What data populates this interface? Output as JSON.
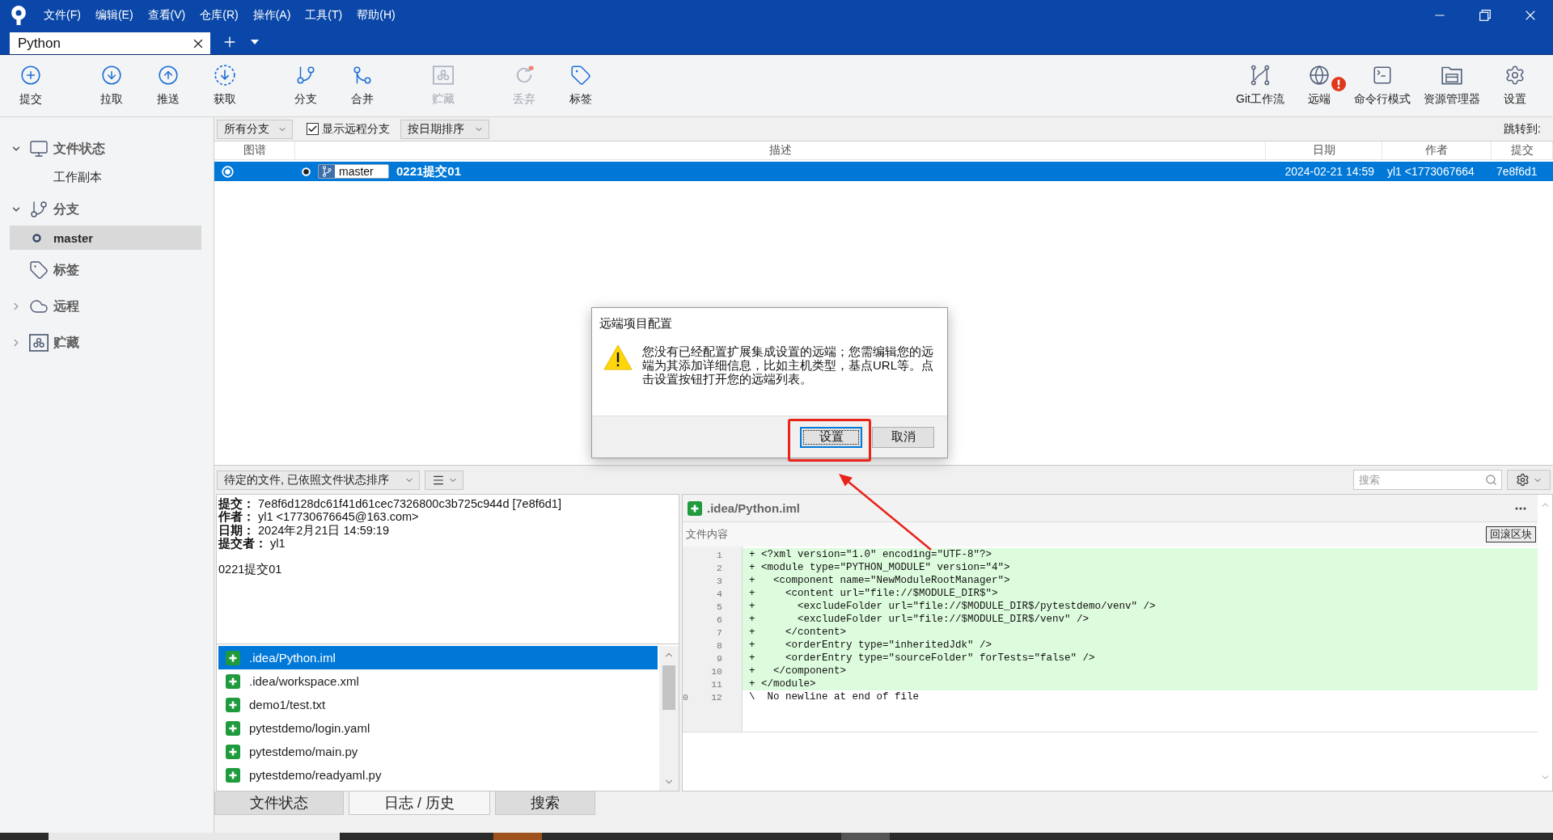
{
  "title_bar": {
    "menu": [
      "文件(F)",
      "编辑(E)",
      "查看(V)",
      "仓库(R)",
      "操作(A)",
      "工具(T)",
      "帮助(H)"
    ]
  },
  "repo_tabs": [
    {
      "label": "Python",
      "selected": true
    }
  ],
  "toolbar": {
    "left_groups": [
      [
        {
          "label": "提交",
          "kind": "commit",
          "disabled": false
        }
      ],
      [
        {
          "label": "拉取",
          "kind": "pull",
          "disabled": false
        },
        {
          "label": "推送",
          "kind": "push",
          "disabled": false
        },
        {
          "label": "获取",
          "kind": "fetch",
          "disabled": false
        }
      ],
      [
        {
          "label": "分支",
          "kind": "branch",
          "disabled": false
        },
        {
          "label": "合并",
          "kind": "merge",
          "disabled": false
        }
      ],
      [
        {
          "label": "贮藏",
          "kind": "stash",
          "disabled": true
        }
      ],
      [
        {
          "label": "丢弃",
          "kind": "discard",
          "disabled": true
        },
        {
          "label": "标签",
          "kind": "tag",
          "disabled": false
        }
      ]
    ],
    "right": [
      {
        "label": "Git工作流",
        "kind": "flow",
        "alert": false
      },
      {
        "label": "远端",
        "kind": "remote",
        "alert": true
      },
      {
        "label": "命令行模式",
        "kind": "terminal",
        "alert": false
      },
      {
        "label": "资源管理器",
        "kind": "explorer",
        "alert": false
      },
      {
        "label": "设置",
        "kind": "settings",
        "alert": false
      }
    ]
  },
  "sidebar": [
    {
      "label": "文件状态",
      "kind": "workspace",
      "expanded": true,
      "children": [
        {
          "label": "工作副本",
          "selected": false,
          "head": false
        }
      ]
    },
    {
      "label": "分支",
      "kind": "branches",
      "expanded": true,
      "children": [
        {
          "label": "master",
          "selected": true,
          "head": true
        }
      ]
    },
    {
      "label": "标签",
      "kind": "tags"
    },
    {
      "label": "远程",
      "kind": "remotes",
      "expanded": false
    },
    {
      "label": "贮藏",
      "kind": "stashes",
      "expanded": false
    }
  ],
  "filter_bar": {
    "branch_filter": "所有分支",
    "show_remote": {
      "label": "显示远程分支",
      "checked": true
    },
    "sort": "按日期排序",
    "jump_label": "跳转到:"
  },
  "commit_table": {
    "columns": [
      "图谱",
      "描述",
      "日期",
      "作者",
      "提交"
    ],
    "rows": [
      {
        "selected": true,
        "branch": "master",
        "description": "0221提交01",
        "date": "2024-02-21 14:59",
        "author": "yl1 <1773067664",
        "commit": "7e8f6d1"
      }
    ]
  },
  "dialog": {
    "title": "远端项目配置",
    "message": "您没有已经配置扩展集成设置的远端；您需编辑您的远端为其添加详细信息，比如主机类型，基点URL等。点击设置按钮打开您的远端列表。",
    "buttons": [
      {
        "label": "设置",
        "focused": true,
        "highlighted": true
      },
      {
        "label": "取消",
        "focused": false,
        "highlighted": false
      }
    ]
  },
  "changes_bar": {
    "file_sort": "待定的文件, 已依照文件状态排序",
    "search": {
      "placeholder": "搜索"
    }
  },
  "commit_details": {
    "fields": [
      {
        "label": "提交：",
        "value": "7e8f6d128dc61f41d61cec7326800c3b725c944d [7e8f6d1]"
      },
      {
        "label": "作者：",
        "value": "yl1 <17730676645@163.com>"
      },
      {
        "label": "日期：",
        "value": "2024年2月21日 14:59:19"
      },
      {
        "label": "提交者：",
        "value": "yl1"
      }
    ],
    "message": "0221提交01"
  },
  "files": [
    {
      "path": ".idea/Python.iml",
      "kind": "added",
      "selected": true
    },
    {
      "path": ".idea/workspace.xml",
      "kind": "added",
      "selected": false
    },
    {
      "path": "demo1/test.txt",
      "kind": "added",
      "selected": false
    },
    {
      "path": "pytestdemo/login.yaml",
      "kind": "added",
      "selected": false
    },
    {
      "path": "pytestdemo/main.py",
      "kind": "added",
      "selected": false
    },
    {
      "path": "pytestdemo/readyaml.py",
      "kind": "added",
      "selected": false
    }
  ],
  "diff": {
    "file": ".idea/Python.iml",
    "kind": "added",
    "section_label": "文件内容",
    "revert_button": "回滚区块",
    "lines": [
      {
        "new": "1",
        "kind": "added",
        "text": "+ <?xml version=\"1.0\" encoding=\"UTF-8\"?>"
      },
      {
        "new": "2",
        "kind": "added",
        "text": "+ <module type=\"PYTHON_MODULE\" version=\"4\">"
      },
      {
        "new": "3",
        "kind": "added",
        "text": "+   <component name=\"NewModuleRootManager\">"
      },
      {
        "new": "4",
        "kind": "added",
        "text": "+     <content url=\"file://$MODULE_DIR$\">"
      },
      {
        "new": "5",
        "kind": "added",
        "text": "+       <excludeFolder url=\"file://$MODULE_DIR$/pytestdemo/venv\" />"
      },
      {
        "new": "6",
        "kind": "added",
        "text": "+       <excludeFolder url=\"file://$MODULE_DIR$/venv\" />"
      },
      {
        "new": "7",
        "kind": "added",
        "text": "+     </content>"
      },
      {
        "new": "8",
        "kind": "added",
        "text": "+     <orderEntry type=\"inheritedJdk\" />"
      },
      {
        "new": "9",
        "kind": "added",
        "text": "+     <orderEntry type=\"sourceFolder\" forTests=\"false\" />"
      },
      {
        "new": "10",
        "kind": "added",
        "text": "+   </component>"
      },
      {
        "new": "11",
        "kind": "added",
        "text": "+ </module>"
      },
      {
        "old": "0",
        "new": "12",
        "kind": "context",
        "text": "\\  No newline at end of file"
      }
    ]
  },
  "bottom_tabs": [
    {
      "label": "文件状态",
      "selected": false
    },
    {
      "label": "日志 / 历史",
      "selected": true
    },
    {
      "label": "搜索",
      "selected": false
    }
  ]
}
